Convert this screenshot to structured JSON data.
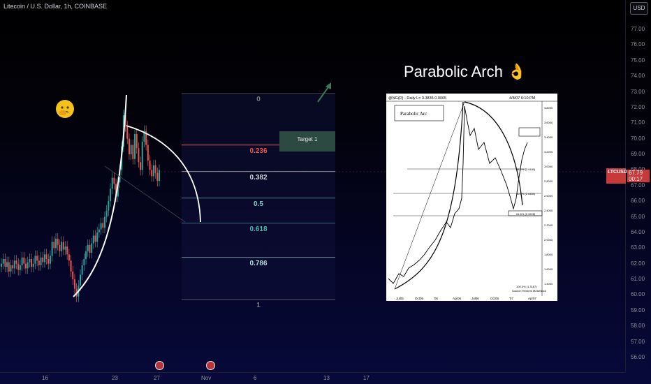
{
  "header": {
    "symbol_title": "Litecoin / U.S. Dollar, 1h, COINBASE",
    "currency_button": "USD"
  },
  "price_tag": {
    "symbol": "LTCUSD",
    "price": "67.79",
    "countdown": "00:17"
  },
  "y_axis_ticks": [
    "77.00",
    "76.00",
    "75.00",
    "74.00",
    "73.00",
    "72.00",
    "71.00",
    "70.00",
    "69.00",
    "68.00",
    "67.00",
    "66.00",
    "65.00",
    "64.00",
    "63.00",
    "62.00",
    "61.00",
    "60.00",
    "59.00",
    "58.00",
    "57.00",
    "56.00"
  ],
  "x_axis_ticks": [
    "16",
    "23",
    "27",
    "Nov",
    "6",
    "13",
    "17"
  ],
  "fib_levels": [
    {
      "label": "0",
      "price": 72.9,
      "color": "#787b86"
    },
    {
      "label": "0.236",
      "price": 69.6,
      "color": "#ef5350"
    },
    {
      "label": "0.382",
      "price": 67.9,
      "color": "#d1d4dc"
    },
    {
      "label": "0.5",
      "price": 66.2,
      "color": "#80cbc4"
    },
    {
      "label": "0.618",
      "price": 64.6,
      "color": "#4db6ac"
    },
    {
      "label": "0.786",
      "price": 62.4,
      "color": "#b2dfdb"
    },
    {
      "label": "1",
      "price": 59.7,
      "color": "#787b86"
    }
  ],
  "target_label": "Target 1",
  "parabolic_title": "Parabolic Arch 👌",
  "inset": {
    "header_left": "@NG(D) - Daily L= 3.3835 0.0065",
    "header_right": "4/8/07 6:10 PM",
    "box_label": "Parabolic Arc",
    "x_labels": [
      "Jul05",
      "Oct05",
      "'06",
      "Apr06",
      "Jul06",
      "Oct06",
      "'07",
      "Apr07"
    ],
    "y_labels": [
      "3.8000",
      "3.6000",
      "3.4000",
      "3.2000",
      "3.0000",
      "2.8000",
      "2.6000",
      "2.4000",
      "2.2000",
      "2.0000",
      "1.8000",
      "1.6000",
      "1.4000"
    ],
    "fib_notes": [
      "38.2% (2.9180)",
      "50.0% (2.6460)",
      "61.8% (2.3228)",
      "100.0% (1.3167)"
    ],
    "footer": "Source: Reuters MetaStock"
  },
  "chart_data": {
    "type": "candlestick",
    "title": "Litecoin / U.S. Dollar, 1h, COINBASE",
    "ylim": [
      55.5,
      77.8
    ],
    "ylabel": "USD",
    "x_ticks": [
      "16",
      "23",
      "27",
      "Nov",
      "6",
      "13",
      "17"
    ],
    "series": [
      {
        "name": "LTCUSD",
        "close": [
          62.0,
          62.3,
          61.8,
          62.1,
          61.5,
          61.9,
          61.7,
          62.2,
          62.0,
          61.6,
          61.9,
          62.4,
          62.0,
          61.7,
          62.1,
          62.3,
          61.8,
          62.0,
          62.5,
          62.2,
          61.9,
          62.4,
          62.1,
          62.6,
          62.3,
          62.0,
          62.5,
          63.4,
          63.0,
          63.6,
          63.2,
          62.8,
          63.4,
          62.9,
          63.1,
          62.6,
          62.2,
          61.5,
          61.0,
          60.4,
          59.9,
          60.6,
          61.3,
          61.9,
          62.3,
          62.8,
          63.2,
          62.7,
          63.3,
          63.8,
          63.4,
          64.0,
          64.2,
          64.6,
          64.3,
          65.0,
          65.4,
          66.0,
          66.8,
          67.5,
          67.1,
          66.3,
          67.2,
          68.0,
          69.5,
          71.5,
          70.8,
          70.0,
          69.0,
          69.6,
          68.7,
          70.3,
          69.4,
          68.5,
          68.0,
          69.8,
          70.5,
          69.6,
          68.6,
          68.0,
          67.6,
          68.3,
          67.8,
          67.3,
          68.0
        ]
      }
    ],
    "current_price": 67.79
  }
}
